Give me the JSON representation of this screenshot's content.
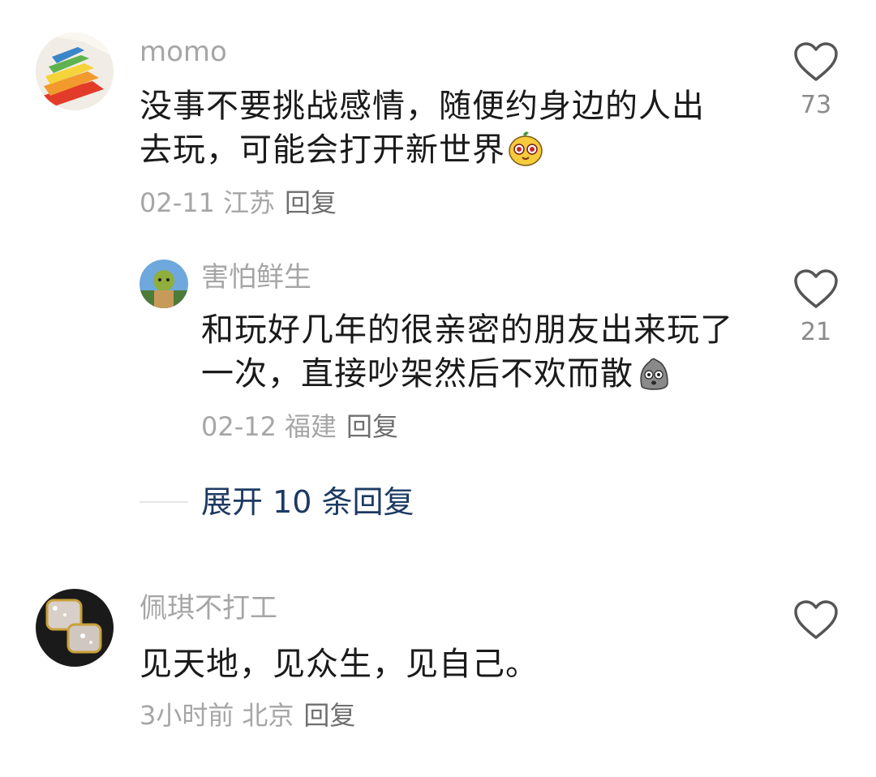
{
  "comments": [
    {
      "username": "momo",
      "content_lines": [
        "没事不要挑战感情，随便约身边的人出",
        "去玩，可能会打开新世界"
      ],
      "emoji": "yellow-face-emoji",
      "date": "02-11",
      "location": "江苏",
      "reply_label": "回复",
      "likes": "73"
    },
    {
      "username": "害怕鲜生",
      "content_lines": [
        "和玩好几年的很亲密的朋友出来玩了",
        "一次，直接吵架然后不欢而散"
      ],
      "emoji": "gray-face-emoji",
      "date": "02-12",
      "location": "福建",
      "reply_label": "回复",
      "likes": "21"
    },
    {
      "username": "佩琪不打工",
      "content_lines": [
        "见天地，见众生，见自己。"
      ],
      "date": "3小时前",
      "location": "北京",
      "reply_label": "回复",
      "likes": ""
    }
  ],
  "expand_replies": "展开 10 条回复",
  "colors": {
    "username": "#a6a6a6",
    "content": "#1a1a1a",
    "expand_link": "#1d3a63",
    "like_icon": "#555555"
  },
  "icons": [
    "heart-outline-icon"
  ]
}
